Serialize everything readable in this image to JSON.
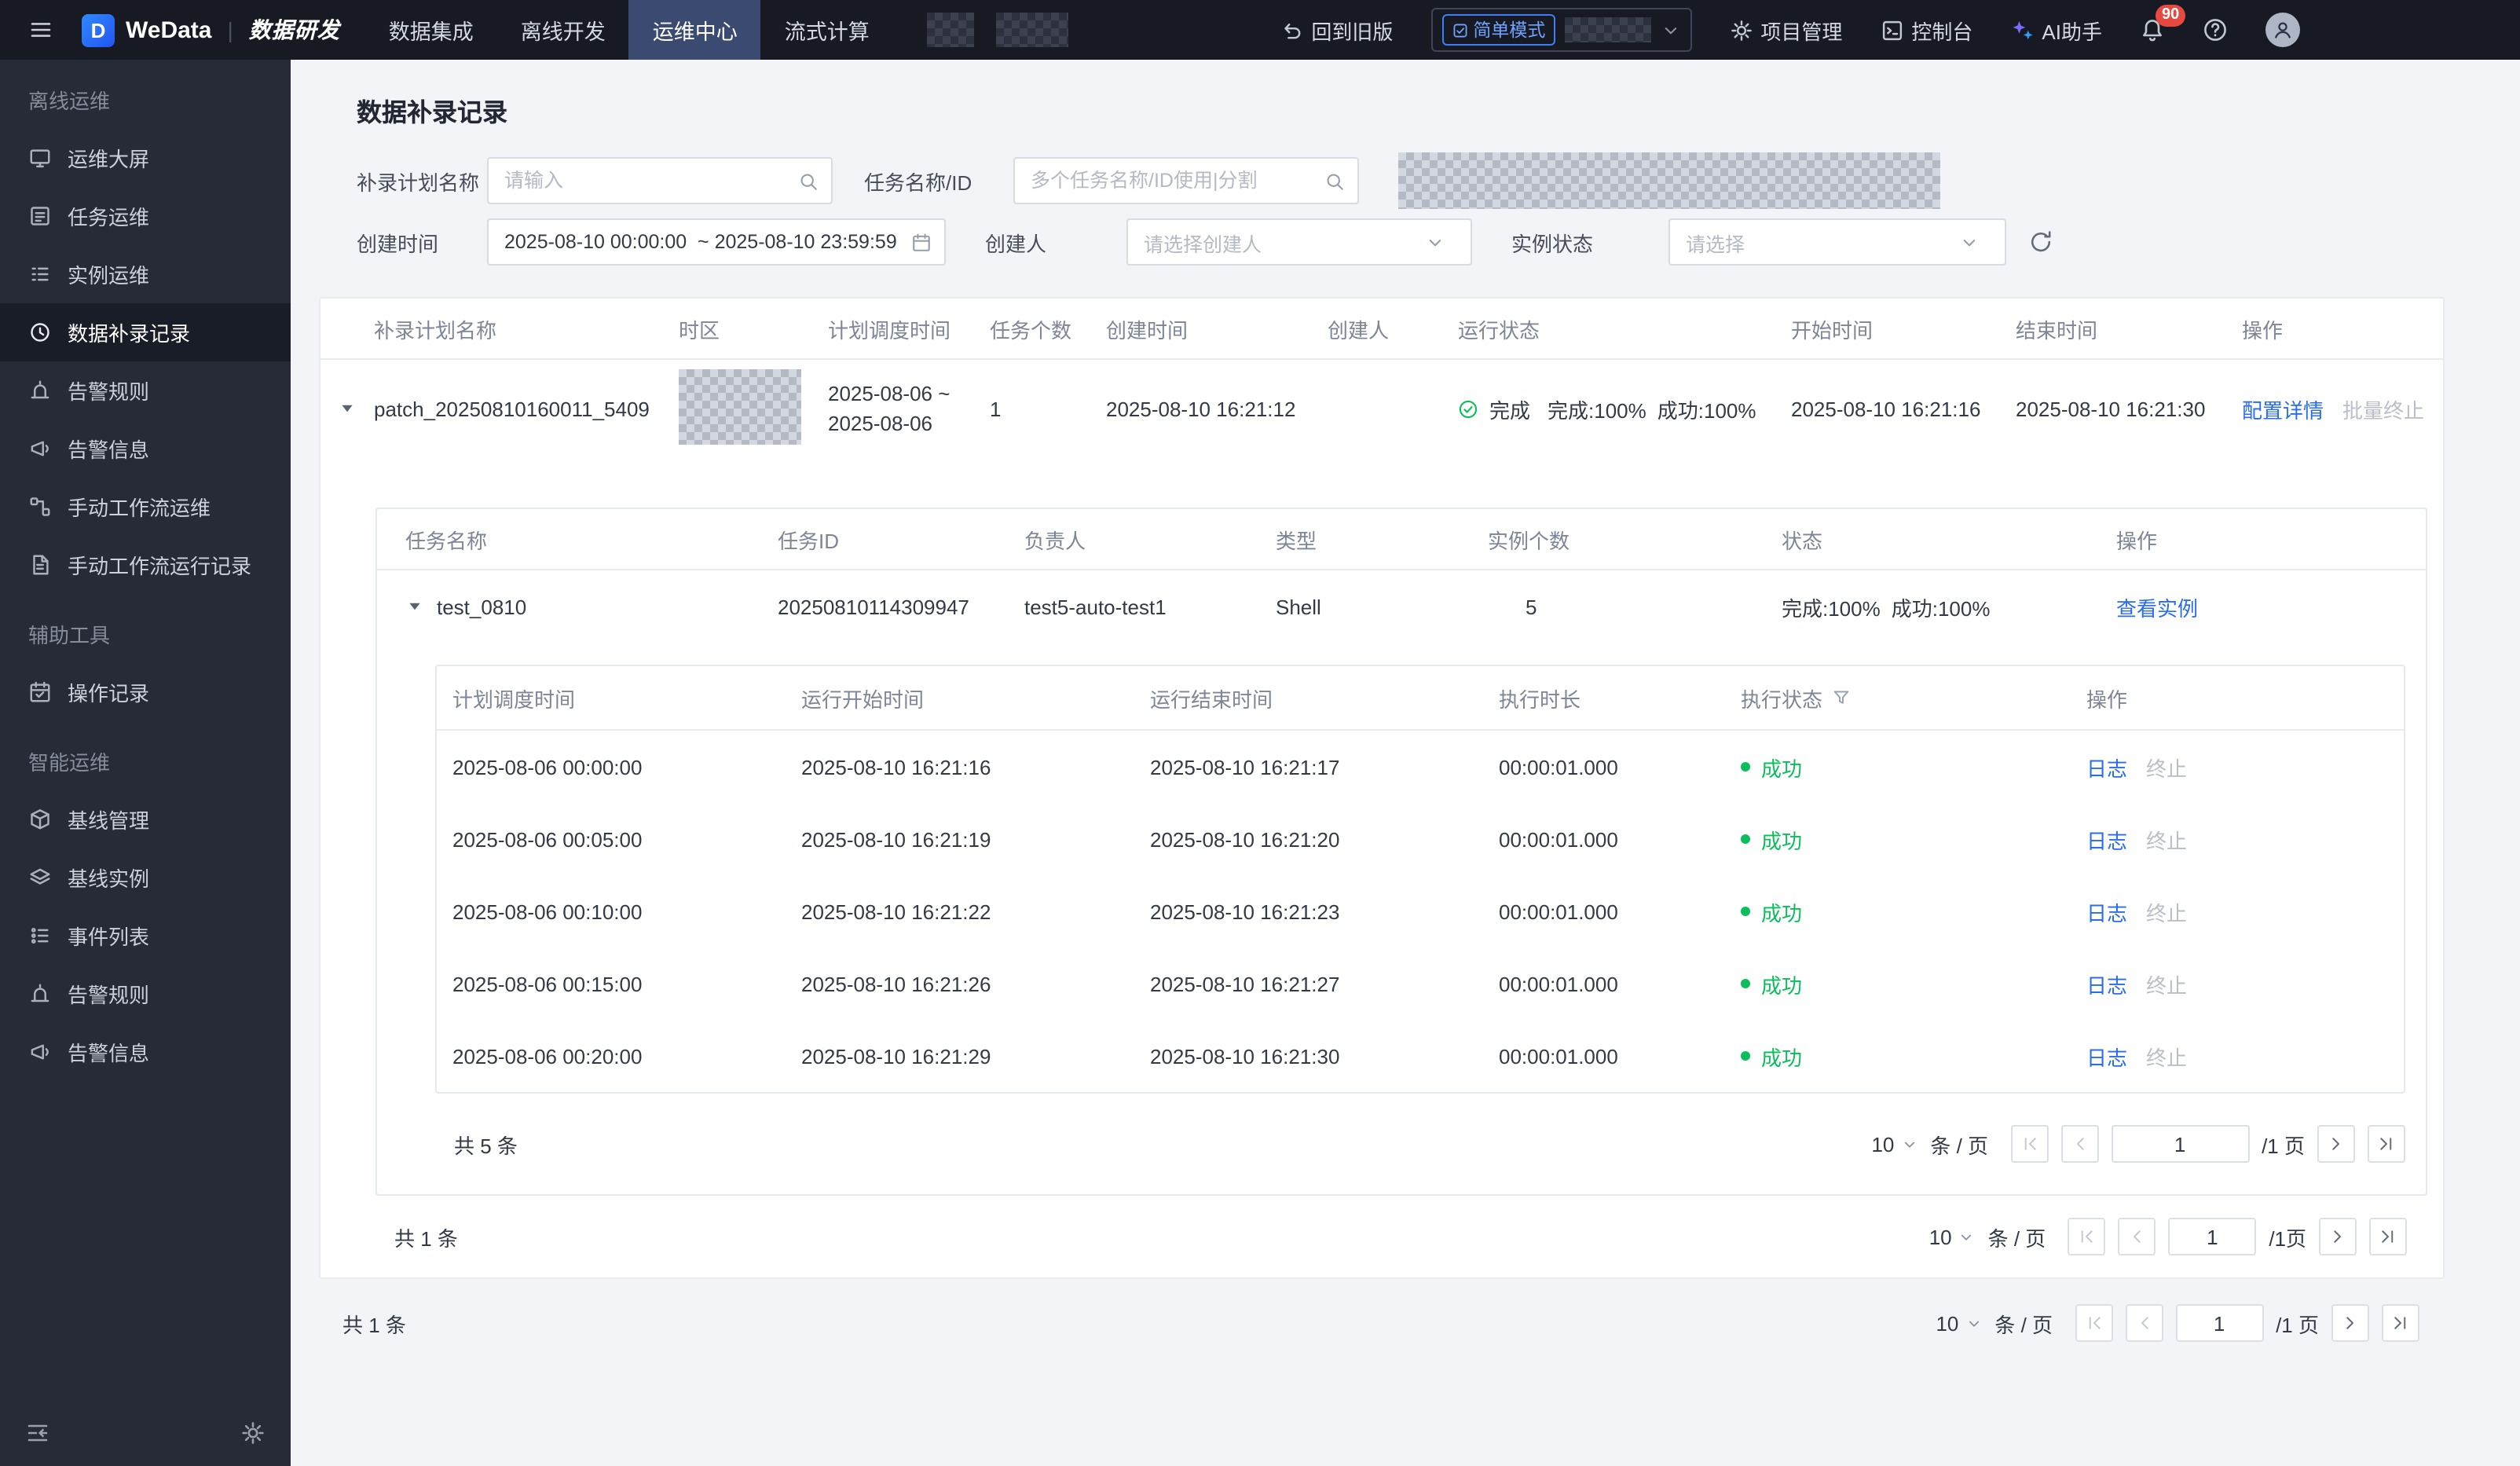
{
  "topnav": {
    "logo_letter": "D",
    "product": "WeData",
    "divider": "|",
    "suite": "数据研发",
    "active_index": 2,
    "items": [
      {
        "label": "数据集成"
      },
      {
        "label": "离线开发"
      },
      {
        "label": "运维中心"
      },
      {
        "label": "流式计算"
      }
    ],
    "back_to_old": "回到旧版",
    "mode_badge": "简单模式",
    "project_mgmt": "项目管理",
    "console": "控制台",
    "ai_assistant": "AI助手",
    "notification_count": "90"
  },
  "sidebar": {
    "active_group": 0,
    "active_item": 3,
    "groups": [
      {
        "label": "离线运维",
        "items": [
          {
            "label": "运维大屏",
            "icon": "screen"
          },
          {
            "label": "任务运维",
            "icon": "tasklist"
          },
          {
            "label": "实例运维",
            "icon": "instancelist"
          },
          {
            "label": "数据补录记录",
            "icon": "history"
          },
          {
            "label": "告警规则",
            "icon": "siren"
          },
          {
            "label": "告警信息",
            "icon": "megaphone"
          },
          {
            "label": "手动工作流运维",
            "icon": "flow"
          },
          {
            "label": "手动工作流运行记录",
            "icon": "doc"
          }
        ]
      },
      {
        "label": "辅助工具",
        "items": [
          {
            "label": "操作记录",
            "icon": "calendar-record"
          }
        ]
      },
      {
        "label": "智能运维",
        "items": [
          {
            "label": "基线管理",
            "icon": "cube"
          },
          {
            "label": "基线实例",
            "icon": "layers"
          },
          {
            "label": "事件列表",
            "icon": "event-list"
          },
          {
            "label": "告警规则",
            "icon": "siren"
          },
          {
            "label": "告警信息",
            "icon": "megaphone"
          }
        ]
      }
    ]
  },
  "page": {
    "title": "数据补录记录"
  },
  "filters": {
    "plan_name_label": "补录计划名称",
    "plan_name_placeholder": "请输入",
    "task_label": "任务名称/ID",
    "task_placeholder": "多个任务名称/ID使用|分割",
    "create_time_label": "创建时间",
    "create_time_value": "2025-08-10 00:00:00  ~ 2025-08-10 23:59:59",
    "creator_label": "创建人",
    "creator_placeholder": "请选择创建人",
    "instance_status_label": "实例状态",
    "instance_status_placeholder": "请选择"
  },
  "plan_table": {
    "headers": [
      "补录计划名称",
      "时区",
      "计划调度时间",
      "任务个数",
      "创建时间",
      "创建人",
      "运行状态",
      "开始时间",
      "结束时间",
      "操作"
    ],
    "row": {
      "name": "patch_20250810160011_5409",
      "schedule_time_line1": "2025-08-06 ~",
      "schedule_time_line2": "2025-08-06",
      "task_count": "1",
      "create_time": "2025-08-10 16:21:12",
      "creator": "",
      "status_label": "完成",
      "status_complete": "完成:100%",
      "status_success": "成功:100%",
      "start_time": "2025-08-10 16:21:16",
      "end_time": "2025-08-10 16:21:30",
      "op_detail": "配置详情",
      "op_batch_stop": "批量终止"
    },
    "footer": {
      "total": "共 1 条",
      "page_size": "10",
      "unit": "条 / 页",
      "page": "1",
      "total_pages": "/1 页"
    }
  },
  "task_table": {
    "headers": [
      "任务名称",
      "任务ID",
      "负责人",
      "类型",
      "实例个数",
      "状态",
      "操作"
    ],
    "row": {
      "name": "test_0810",
      "id": "20250810114309947",
      "owner": "test5-auto-test1",
      "type": "Shell",
      "instance_count": "5",
      "status_complete": "完成:100%",
      "status_success": "成功:100%",
      "op_view": "查看实例"
    },
    "footer": {
      "total": "共 1 条",
      "page_size": "10",
      "unit": "条 / 页",
      "page": "1",
      "total_pages": "/1页"
    }
  },
  "instance_table": {
    "headers": [
      "计划调度时间",
      "运行开始时间",
      "运行结束时间",
      "执行时长",
      "执行状态",
      "操作"
    ],
    "rows": [
      {
        "plan_time": "2025-08-06 00:00:00",
        "start": "2025-08-10 16:21:16",
        "end": "2025-08-10 16:21:17",
        "duration": "00:00:01.000",
        "status": "成功",
        "op_log": "日志",
        "op_stop": "终止"
      },
      {
        "plan_time": "2025-08-06 00:05:00",
        "start": "2025-08-10 16:21:19",
        "end": "2025-08-10 16:21:20",
        "duration": "00:00:01.000",
        "status": "成功",
        "op_log": "日志",
        "op_stop": "终止"
      },
      {
        "plan_time": "2025-08-06 00:10:00",
        "start": "2025-08-10 16:21:22",
        "end": "2025-08-10 16:21:23",
        "duration": "00:00:01.000",
        "status": "成功",
        "op_log": "日志",
        "op_stop": "终止"
      },
      {
        "plan_time": "2025-08-06 00:15:00",
        "start": "2025-08-10 16:21:26",
        "end": "2025-08-10 16:21:27",
        "duration": "00:00:01.000",
        "status": "成功",
        "op_log": "日志",
        "op_stop": "终止"
      },
      {
        "plan_time": "2025-08-06 00:20:00",
        "start": "2025-08-10 16:21:29",
        "end": "2025-08-10 16:21:30",
        "duration": "00:00:01.000",
        "status": "成功",
        "op_log": "日志",
        "op_stop": "终止"
      }
    ],
    "footer": {
      "total": "共 5 条",
      "page_size": "10",
      "unit": "条 / 页",
      "page": "1",
      "total_pages": "/1 页"
    }
  },
  "colors": {
    "accent_blue": "#2a6cf0",
    "success_green": "#0abf5b",
    "badge_red": "#e6493f",
    "nav_active": "#3b4a70"
  }
}
